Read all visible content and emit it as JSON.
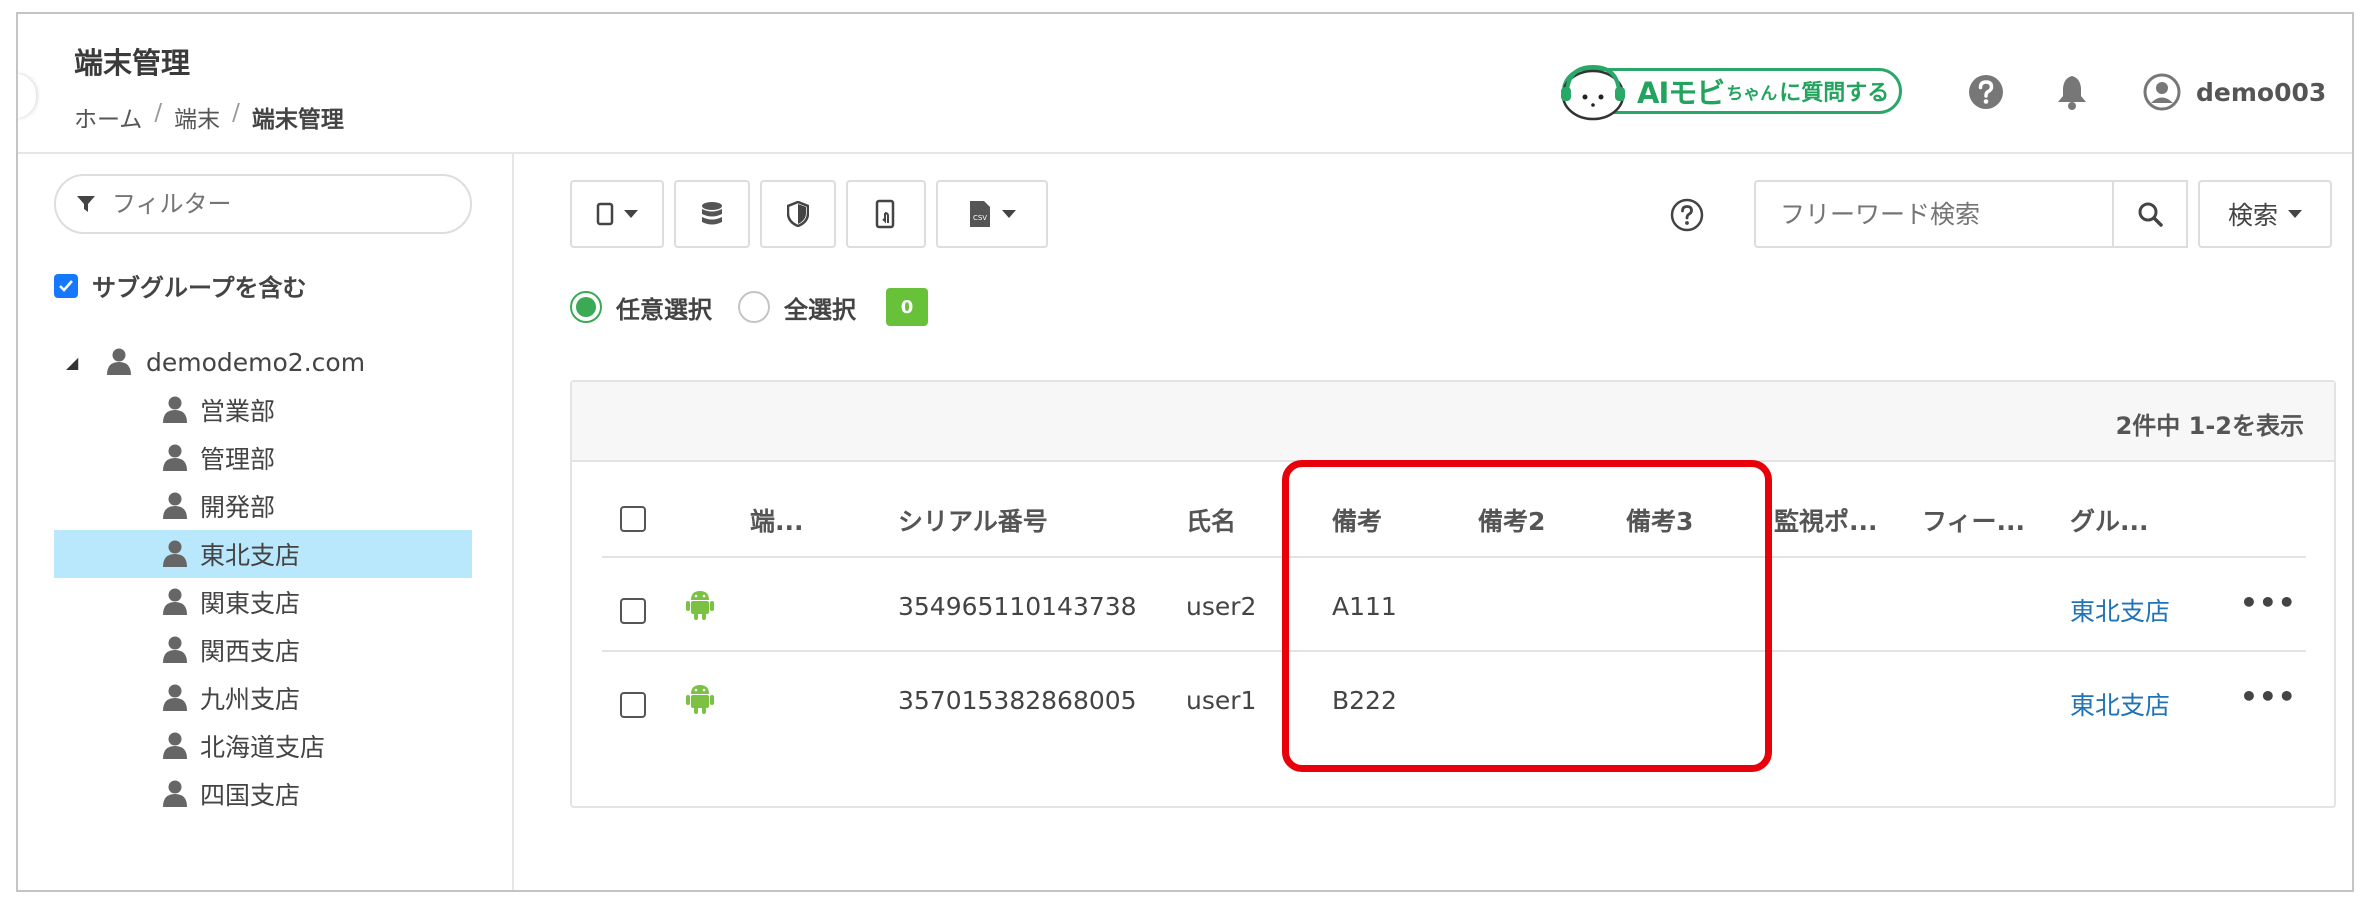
{
  "header": {
    "title": "端末管理",
    "breadcrumb": [
      "ホーム",
      "端末",
      "端末管理"
    ],
    "ai_button": {
      "big": "AIモビ",
      "small": "ちゃん",
      "tail": "に質問する"
    },
    "user": "demo003"
  },
  "sidebar": {
    "filter_placeholder": "フィルター",
    "include_subgroups": "サブグループを含む",
    "root": "demodemo2.com",
    "groups": [
      "営業部",
      "管理部",
      "開発部",
      "東北支店",
      "関東支店",
      "関西支店",
      "九州支店",
      "北海道支店",
      "四国支店"
    ],
    "selected": "東北支店"
  },
  "toolbar": {
    "search_placeholder": "フリーワード検索",
    "search_menu": "検索"
  },
  "selection": {
    "any": "任意選択",
    "all": "全選択",
    "count": "0"
  },
  "table": {
    "paging": "2件中 1-2を表示",
    "columns": [
      "端...",
      "シリアル番号",
      "氏名",
      "備考",
      "備考2",
      "備考3",
      "監視ポ...",
      "フィー...",
      "グル..."
    ],
    "rows": [
      {
        "serial": "354965110143738",
        "name": "user2",
        "note": "A111",
        "note2": "",
        "note3": "",
        "group": "東北支店",
        "more": "•••"
      },
      {
        "serial": "357015382868005",
        "name": "user1",
        "note": "B222",
        "note2": "",
        "note3": "",
        "group": "東北支店",
        "more": "•••"
      }
    ]
  },
  "colors": {
    "accent_green": "#3aaa55",
    "badge_green": "#67c23a",
    "selected_bg": "#b9e7fb",
    "link": "#1f73b7",
    "highlight_red": "#e8000b",
    "android_green": "#7cc242"
  }
}
